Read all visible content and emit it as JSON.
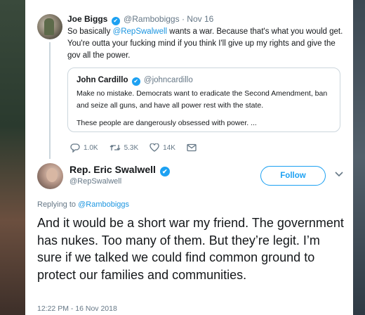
{
  "colors": {
    "accent": "#1da1f2",
    "link": "#1b95e0",
    "muted": "#657786",
    "border": "#ccd6dd"
  },
  "parent_tweet": {
    "name": "Joe Biggs",
    "handle": "@Rambobiggs",
    "separator": "·",
    "date": "Nov 16",
    "text_before_mention": "So basically ",
    "mention": "@RepSwalwell",
    "text_after_mention": " wants a war. Because that's what you would get. You're outta your fucking mind if you think I'll give up my rights and give the gov all the power.",
    "quote": {
      "name": "John Cardillo",
      "handle": "@johncardillo",
      "line1": "Make no mistake. Democrats want to eradicate the Second Amendment, ban and seize all guns, and have all power rest with the state.",
      "line2": "These people are dangerously obsessed with power.  ..."
    },
    "actions": {
      "replies": "1.0K",
      "retweets": "5.3K",
      "likes": "14K"
    }
  },
  "main_tweet": {
    "name": "Rep. Eric Swalwell",
    "handle": "@RepSwalwell",
    "follow_label": "Follow",
    "replying_prefix": "Replying to ",
    "replying_handle": "@Rambobiggs",
    "text": "And it would be a short war my friend. The government has nukes. Too many of them. But they’re legit. I’m sure if we talked we could find common ground to protect our families and communities.",
    "timestamp": "12:22 PM - 16 Nov 2018"
  },
  "icons": [
    "verified-icon",
    "reply-icon",
    "retweet-icon",
    "like-icon",
    "dm-icon",
    "chevron-down-icon"
  ]
}
